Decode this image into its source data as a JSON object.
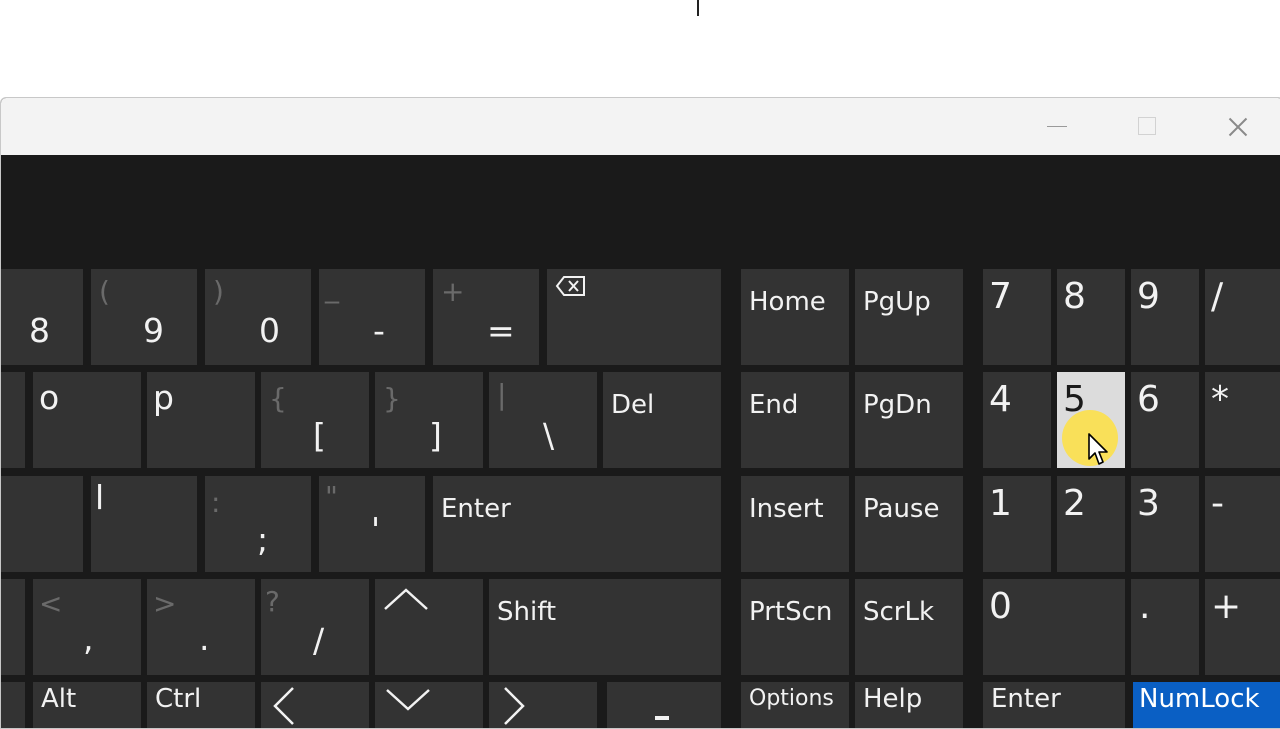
{
  "window": {
    "minimize": "",
    "maximize": "",
    "close": ""
  },
  "keys": {
    "k8": {
      "main": "8"
    },
    "k9": {
      "main": "9",
      "shift": "("
    },
    "k0": {
      "main": "0",
      "shift": ")"
    },
    "kminus": {
      "main": "-",
      "shift": "_"
    },
    "kequals": {
      "main": "=",
      "shift": "+"
    },
    "o": {
      "main": "o"
    },
    "p": {
      "main": "p"
    },
    "lbracket": {
      "main": "[",
      "shift": "{"
    },
    "rbracket": {
      "main": "]",
      "shift": "}"
    },
    "backslash": {
      "main": "\\",
      "shift": "|"
    },
    "del": {
      "label": "Del"
    },
    "l": {
      "main": "l"
    },
    "semicolon": {
      "main": ";",
      "shift": ":"
    },
    "quote": {
      "main": "'",
      "shift": "\""
    },
    "enter": {
      "label": "Enter"
    },
    "comma": {
      "main": ",",
      "shift": "<"
    },
    "period": {
      "main": ".",
      "shift": ">"
    },
    "slash": {
      "main": "/",
      "shift": "?"
    },
    "shift": {
      "label": "Shift"
    },
    "alt": {
      "label": "Alt"
    },
    "ctrl": {
      "label": "Ctrl"
    },
    "home": {
      "label": "Home"
    },
    "pgup": {
      "label": "PgUp"
    },
    "end": {
      "label": "End"
    },
    "pgdn": {
      "label": "PgDn"
    },
    "insert": {
      "label": "Insert"
    },
    "pause": {
      "label": "Pause"
    },
    "prtscn": {
      "label": "PrtScn"
    },
    "scrlk": {
      "label": "ScrLk"
    },
    "options": {
      "label": "Options"
    },
    "help": {
      "label": "Help"
    },
    "np7": {
      "label": "7"
    },
    "np8": {
      "label": "8"
    },
    "np9": {
      "label": "9"
    },
    "npdiv": {
      "label": "/"
    },
    "np4": {
      "label": "4"
    },
    "np5": {
      "label": "5"
    },
    "np6": {
      "label": "6"
    },
    "npmul": {
      "label": "*"
    },
    "np1": {
      "label": "1"
    },
    "np2": {
      "label": "2"
    },
    "np3": {
      "label": "3"
    },
    "npminus": {
      "label": "-"
    },
    "np0": {
      "label": "0"
    },
    "npdot": {
      "label": "."
    },
    "npplus": {
      "label": "+"
    },
    "npenter": {
      "label": "Enter"
    },
    "numlock": {
      "label": "NumLock"
    }
  },
  "state": {
    "hovered_key": "5",
    "active_key": "NumLock"
  }
}
